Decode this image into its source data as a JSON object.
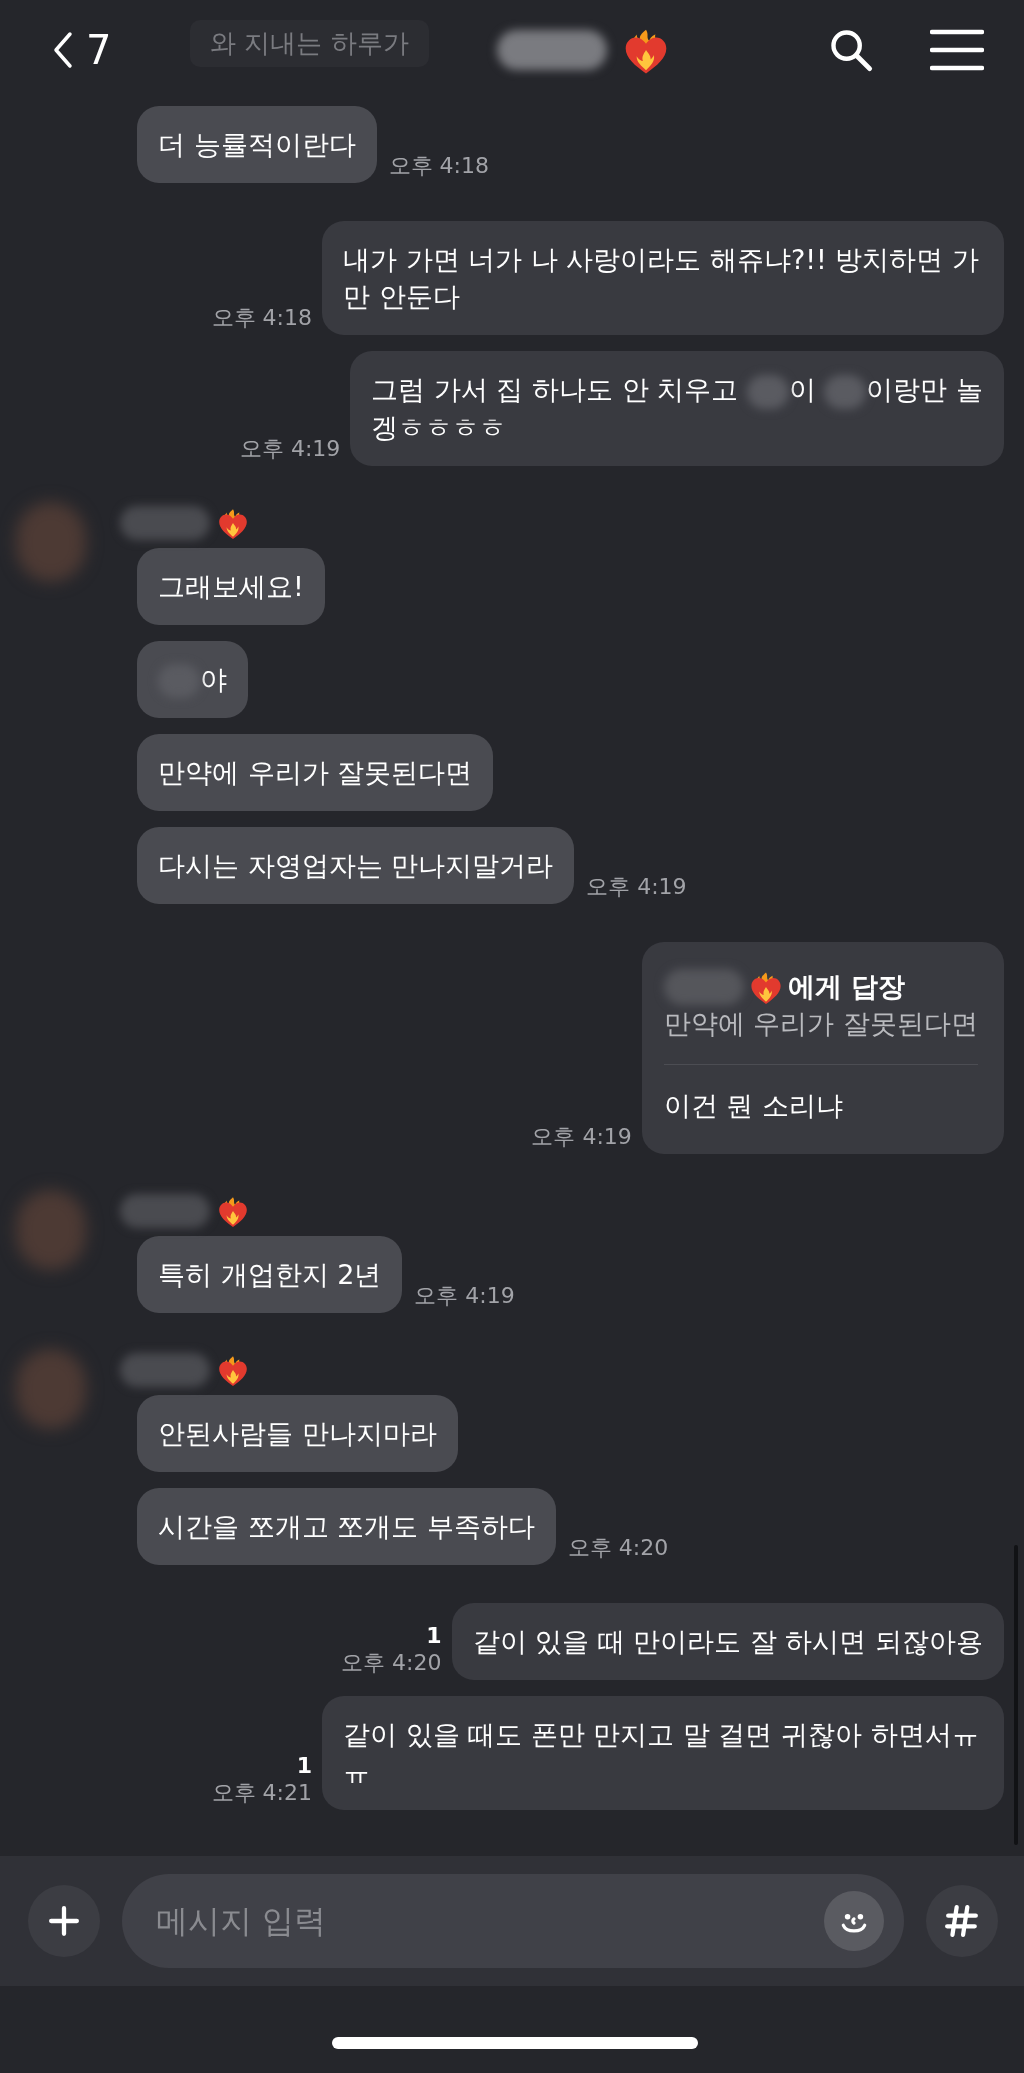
{
  "header": {
    "back_count": "7",
    "faded_preview": "와 지내는 하루가"
  },
  "messages": [
    {
      "kind": "in",
      "parts": [
        {
          "kind": "text",
          "text": "더 능률적이란다"
        }
      ],
      "time": "오후 4:18"
    },
    {
      "kind": "out",
      "parts": [
        {
          "kind": "text",
          "text": "내가 가면 너가 나 사랑이라도 해쥬냐?!! 방치하면 가만 안둔다"
        }
      ],
      "time": "오후 4:18"
    },
    {
      "kind": "out",
      "parts": [
        {
          "kind": "text",
          "text": "그럼 가서 집 하나도 안 치우고 "
        },
        {
          "kind": "blur"
        },
        {
          "kind": "text",
          "text": "이 "
        },
        {
          "kind": "blur"
        },
        {
          "kind": "text",
          "text": "이랑만 놀"
        },
        {
          "kind": "break"
        },
        {
          "kind": "text",
          "text": "겡ㅎㅎㅎㅎ"
        }
      ],
      "time": "오후 4:19"
    },
    {
      "kind": "sender"
    },
    {
      "kind": "in",
      "parts": [
        {
          "kind": "text",
          "text": "그래보세요!"
        }
      ]
    },
    {
      "kind": "in",
      "parts": [
        {
          "kind": "blur"
        },
        {
          "kind": "text",
          "text": "야"
        }
      ]
    },
    {
      "kind": "in",
      "parts": [
        {
          "kind": "text",
          "text": "만약에 우리가 잘못된다면"
        }
      ]
    },
    {
      "kind": "in",
      "parts": [
        {
          "kind": "text",
          "text": "다시는 자영업자는 만나지말거라"
        }
      ],
      "time": "오후 4:19"
    },
    {
      "kind": "reply",
      "reply_to": "에게 답장",
      "quoted": "만약에 우리가 잘못된다면",
      "text": "이건 뭔 소리냐",
      "time": "오후 4:19"
    },
    {
      "kind": "sender"
    },
    {
      "kind": "in",
      "parts": [
        {
          "kind": "text",
          "text": "특히 개업한지 2년"
        }
      ],
      "time": "오후 4:19"
    },
    {
      "kind": "sender"
    },
    {
      "kind": "in",
      "parts": [
        {
          "kind": "text",
          "text": "안된사람들 만나지마라"
        }
      ]
    },
    {
      "kind": "in",
      "parts": [
        {
          "kind": "text",
          "text": "시간을 쪼개고 쪼개도 부족하다"
        }
      ],
      "time": "오후 4:20"
    },
    {
      "kind": "out",
      "parts": [
        {
          "kind": "text",
          "text": "같이 있을 때 만이라도 잘 하시면 되잖아용"
        }
      ],
      "unread": "1",
      "time": "오후 4:20"
    },
    {
      "kind": "out",
      "parts": [
        {
          "kind": "text",
          "text": "같이 있을 때도 폰만 만지고 말 걸면 귀찮아 하면서ㅠㅠ"
        }
      ],
      "unread": "1",
      "time": "오후 4:21"
    }
  ],
  "composer": {
    "placeholder": "메시지 입력"
  }
}
